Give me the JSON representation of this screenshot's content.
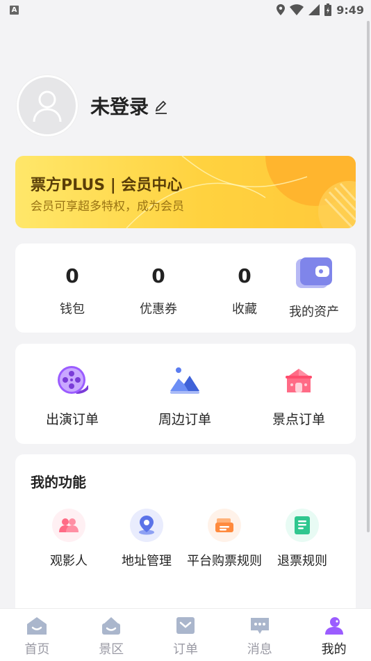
{
  "status_bar": {
    "time": "9:49",
    "notification_icon": "A"
  },
  "profile": {
    "username": "未登录"
  },
  "vip": {
    "title": "票方PLUS | 会员中心",
    "subtitle": "会员可享超多特权，成为会员"
  },
  "assets": {
    "items": [
      {
        "value": "0",
        "label": "钱包"
      },
      {
        "value": "0",
        "label": "优惠券"
      },
      {
        "value": "0",
        "label": "收藏"
      }
    ],
    "my_assets_label": "我的资产"
  },
  "orders": {
    "items": [
      {
        "label": "出演订单",
        "icon": "film-reel-icon"
      },
      {
        "label": "周边订单",
        "icon": "mountain-icon"
      },
      {
        "label": "景点订单",
        "icon": "temple-icon"
      }
    ]
  },
  "functions": {
    "title": "我的功能",
    "items": [
      {
        "label": "观影人",
        "icon": "people-icon"
      },
      {
        "label": "地址管理",
        "icon": "location-icon"
      },
      {
        "label": "平台购票规则",
        "icon": "ticket-icon"
      },
      {
        "label": "退票规则",
        "icon": "document-icon"
      }
    ]
  },
  "tabbar": {
    "items": [
      {
        "label": "首页",
        "active": false
      },
      {
        "label": "景区",
        "active": false
      },
      {
        "label": "订单",
        "active": false
      },
      {
        "label": "消息",
        "active": false
      },
      {
        "label": "我的",
        "active": true
      }
    ]
  },
  "colors": {
    "accent": "#9b5cff",
    "vip_yellow": "#ffd23f",
    "background": "#f3f3f5"
  }
}
